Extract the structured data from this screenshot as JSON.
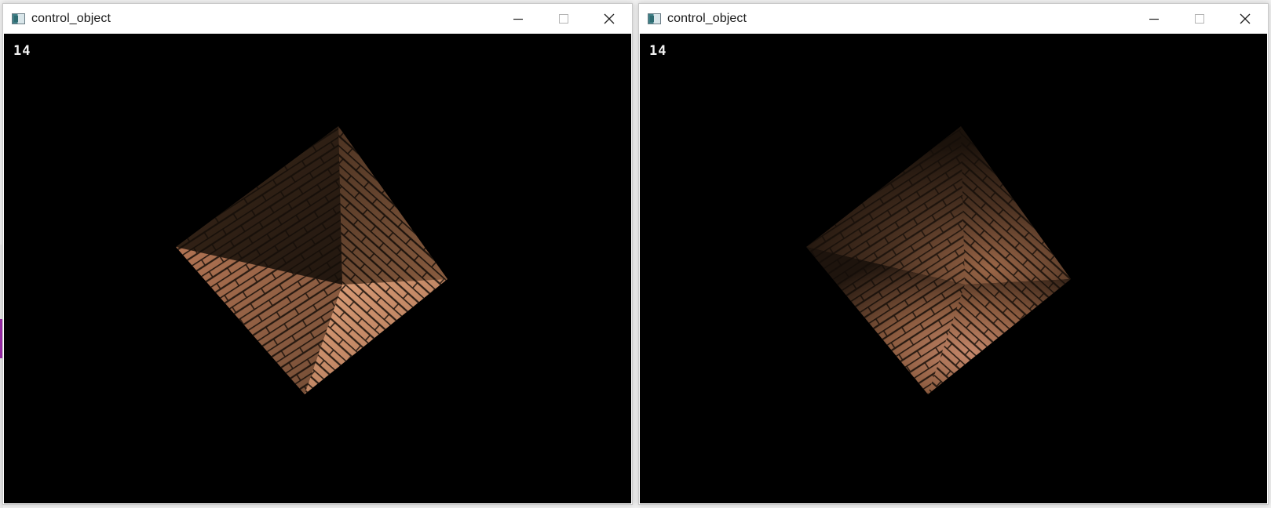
{
  "windows": [
    {
      "title": "control_object",
      "fps_text": "14",
      "shading": "flat"
    },
    {
      "title": "control_object",
      "fps_text": "14",
      "shading": "smooth"
    }
  ],
  "caption_buttons": {
    "minimize_icon": "minimize-icon",
    "maximize_icon": "maximize-icon",
    "close_icon": "close-icon"
  },
  "colors": {
    "viewport_background": "#000000",
    "brick_light": "#d9936c",
    "brick_mid": "#8a5a3e",
    "brick_dark": "#3a2618",
    "mortar": "#1c140e"
  }
}
